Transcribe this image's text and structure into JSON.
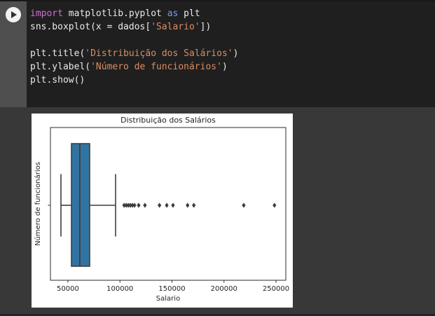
{
  "cell": {
    "run_button_label": "run-cell",
    "syntax_colors": {
      "keyword_import": "#d16fd1",
      "keyword_as": "#6c9ef5",
      "string": "#db8d62",
      "plain": "#e8eaed"
    },
    "code_lines": [
      {
        "tokens": [
          {
            "t": "import",
            "c": "keyword_import"
          },
          {
            "t": " matplotlib.pyplot ",
            "c": "plain"
          },
          {
            "t": "as",
            "c": "keyword_as"
          },
          {
            "t": " plt",
            "c": "plain"
          }
        ]
      },
      {
        "tokens": [
          {
            "t": "sns.boxplot(x = dados[",
            "c": "plain"
          },
          {
            "t": "'Salario'",
            "c": "string"
          },
          {
            "t": "])",
            "c": "plain"
          }
        ]
      },
      {
        "tokens": []
      },
      {
        "tokens": [
          {
            "t": "plt.title(",
            "c": "plain"
          },
          {
            "t": "'Distribuição dos Salários'",
            "c": "string"
          },
          {
            "t": ")",
            "c": "plain"
          }
        ]
      },
      {
        "tokens": [
          {
            "t": "plt.ylabel(",
            "c": "plain"
          },
          {
            "t": "'Número de funcionários'",
            "c": "string"
          },
          {
            "t": ")",
            "c": "plain"
          }
        ]
      },
      {
        "tokens": [
          {
            "t": "plt.show()",
            "c": "plain"
          }
        ]
      }
    ]
  },
  "chart_data": {
    "type": "boxplot",
    "orientation": "horizontal",
    "title": "Distribuição dos Salários",
    "xlabel": "Salario",
    "ylabel": "Número de funcionários",
    "xlim": [
      33200,
      259400
    ],
    "xticks": [
      50000,
      100000,
      150000,
      200000,
      250000
    ],
    "grid": false,
    "legend": null,
    "stats": {
      "whisker_low": 43300,
      "q1": 53400,
      "median": 61400,
      "q3": 70900,
      "whisker_high": 95800
    },
    "outliers": [
      104000,
      106000,
      108000,
      110000,
      112000,
      114000,
      118000,
      124000,
      138000,
      145000,
      151000,
      165000,
      171000,
      219000,
      248500
    ],
    "colors": {
      "box_fill": "#3274a1",
      "line": "#3d3d3d",
      "axis": "#2b2b2b",
      "text": "#1f1f1f",
      "figure_bg": "#ffffff"
    }
  }
}
